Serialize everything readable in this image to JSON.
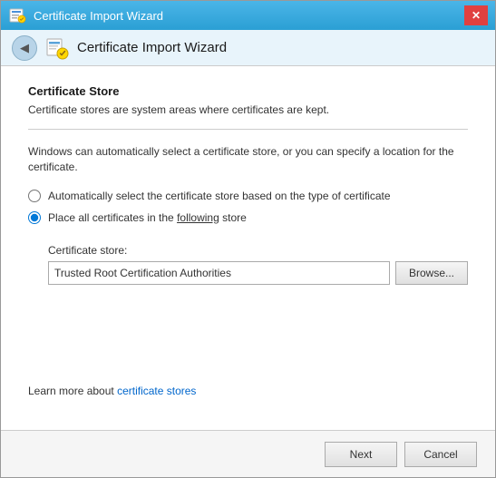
{
  "window": {
    "title": "Certificate Import Wizard",
    "close_label": "✕"
  },
  "nav": {
    "back_icon": "◀",
    "title": "Certificate Import Wizard"
  },
  "content": {
    "section_title": "Certificate Store",
    "section_description": "Certificate stores are system areas where certificates are kept.",
    "info_text_part1": "Windows can automatically select a certificate store, or you can specify a location for the certificate.",
    "radio_auto_label": "Automatically select the certificate store based on the type of certificate",
    "radio_manual_label_prefix": "Place all certificates in the",
    "radio_manual_label_underline": "following",
    "radio_manual_label_suffix": "store",
    "cert_store_label": "Certificate store:",
    "cert_store_value": "Trusted Root Certification Authorities",
    "browse_label": "Browse...",
    "learn_more_prefix": "Learn more about ",
    "learn_more_link": "certificate stores"
  },
  "footer": {
    "next_label": "Next",
    "cancel_label": "Cancel"
  }
}
